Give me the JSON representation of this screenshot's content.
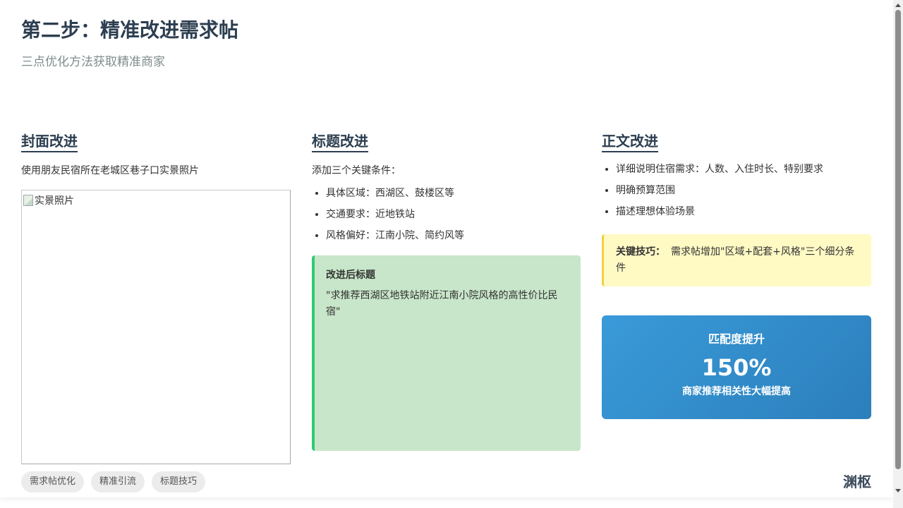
{
  "header": {
    "title": "第二步：精准改进需求帖",
    "subtitle": "三点优化方法获取精准商家"
  },
  "cover": {
    "title": "封面改进",
    "text": "使用朋友民宿所在老城区巷子口实景照片",
    "photo_alt": "实景照片"
  },
  "headline": {
    "title": "标题改进",
    "intro": "添加三个关键条件：",
    "items": [
      "具体区域：西湖区、鼓楼区等",
      "交通要求：近地铁站",
      "风格偏好：江南小院、简约风等"
    ],
    "improved_label": "改进后标题",
    "improved_text": "\"求推荐西湖区地铁站附近江南小院风格的高性价比民宿\""
  },
  "body_section": {
    "title": "正文改进",
    "items": [
      "详细说明住宿需求：人数、入住时长、特别要求",
      "明确预算范围",
      "描述理想体验场景"
    ],
    "tip_label": "关键技巧：",
    "tip_text": "需求帖增加\"区域+配套+风格\"三个细分条件"
  },
  "stat": {
    "label": "匹配度提升",
    "value": "150%",
    "desc": "商家推荐相关性大幅提高"
  },
  "tags": [
    "需求帖优化",
    "精准引流",
    "标题技巧"
  ],
  "brand": "渊枢",
  "colors": {
    "title": "#2c3e50",
    "green_accent": "#2ecc71",
    "green_bg": "#c8e6c9",
    "tip_accent": "#f4d03f",
    "tip_bg": "#fff9c4",
    "stat_gradient_start": "#3a9ad9",
    "stat_gradient_end": "#2b7fbb"
  }
}
